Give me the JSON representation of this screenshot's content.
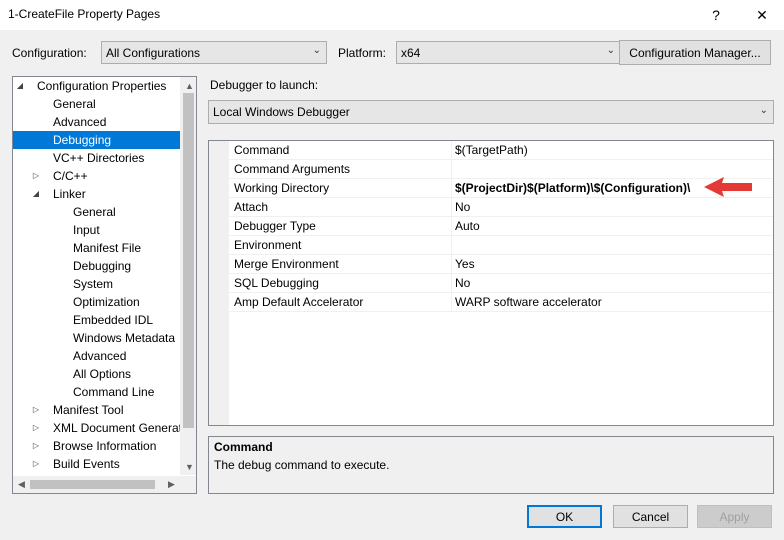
{
  "window": {
    "title": "1-CreateFile Property Pages",
    "help_glyph": "?",
    "close_glyph": "✕"
  },
  "top": {
    "configuration_label": "Configuration:",
    "configuration_value": "All Configurations",
    "platform_label": "Platform:",
    "platform_value": "x64",
    "config_manager_label": "Configuration Manager..."
  },
  "tree": {
    "items": [
      {
        "label": "Configuration Properties",
        "level": 0,
        "expander": "expanded"
      },
      {
        "label": "General",
        "level": 1,
        "expander": "none"
      },
      {
        "label": "Advanced",
        "level": 1,
        "expander": "none"
      },
      {
        "label": "Debugging",
        "level": 1,
        "expander": "none",
        "selected": true
      },
      {
        "label": "VC++ Directories",
        "level": 1,
        "expander": "none"
      },
      {
        "label": "C/C++",
        "level": 1,
        "expander": "collapsed"
      },
      {
        "label": "Linker",
        "level": 1,
        "expander": "expanded"
      },
      {
        "label": "General",
        "level": 2,
        "expander": "none"
      },
      {
        "label": "Input",
        "level": 2,
        "expander": "none"
      },
      {
        "label": "Manifest File",
        "level": 2,
        "expander": "none"
      },
      {
        "label": "Debugging",
        "level": 2,
        "expander": "none"
      },
      {
        "label": "System",
        "level": 2,
        "expander": "none"
      },
      {
        "label": "Optimization",
        "level": 2,
        "expander": "none"
      },
      {
        "label": "Embedded IDL",
        "level": 2,
        "expander": "none"
      },
      {
        "label": "Windows Metadata",
        "level": 2,
        "expander": "none"
      },
      {
        "label": "Advanced",
        "level": 2,
        "expander": "none"
      },
      {
        "label": "All Options",
        "level": 2,
        "expander": "none"
      },
      {
        "label": "Command Line",
        "level": 2,
        "expander": "none"
      },
      {
        "label": "Manifest Tool",
        "level": 1,
        "expander": "collapsed"
      },
      {
        "label": "XML Document Generator",
        "level": 1,
        "expander": "collapsed"
      },
      {
        "label": "Browse Information",
        "level": 1,
        "expander": "collapsed"
      },
      {
        "label": "Build Events",
        "level": 1,
        "expander": "collapsed"
      }
    ]
  },
  "debugger": {
    "label": "Debugger to launch:",
    "value": "Local Windows Debugger"
  },
  "grid": {
    "rows": [
      {
        "name": "Command",
        "value": "$(TargetPath)",
        "bold": false
      },
      {
        "name": "Command Arguments",
        "value": "",
        "bold": false
      },
      {
        "name": "Working Directory",
        "value": "$(ProjectDir)$(Platform)\\$(Configuration)\\",
        "bold": true
      },
      {
        "name": "Attach",
        "value": "No",
        "bold": false
      },
      {
        "name": "Debugger Type",
        "value": "Auto",
        "bold": false
      },
      {
        "name": "Environment",
        "value": "",
        "bold": false
      },
      {
        "name": "Merge Environment",
        "value": "Yes",
        "bold": false
      },
      {
        "name": "SQL Debugging",
        "value": "No",
        "bold": false
      },
      {
        "name": "Amp Default Accelerator",
        "value": "WARP software accelerator",
        "bold": false
      }
    ]
  },
  "description": {
    "title": "Command",
    "text": "The debug command to execute."
  },
  "buttons": {
    "ok": "OK",
    "cancel": "Cancel",
    "apply": "Apply"
  },
  "colors": {
    "selection": "#0078d7",
    "annotation_arrow": "#e53935"
  }
}
